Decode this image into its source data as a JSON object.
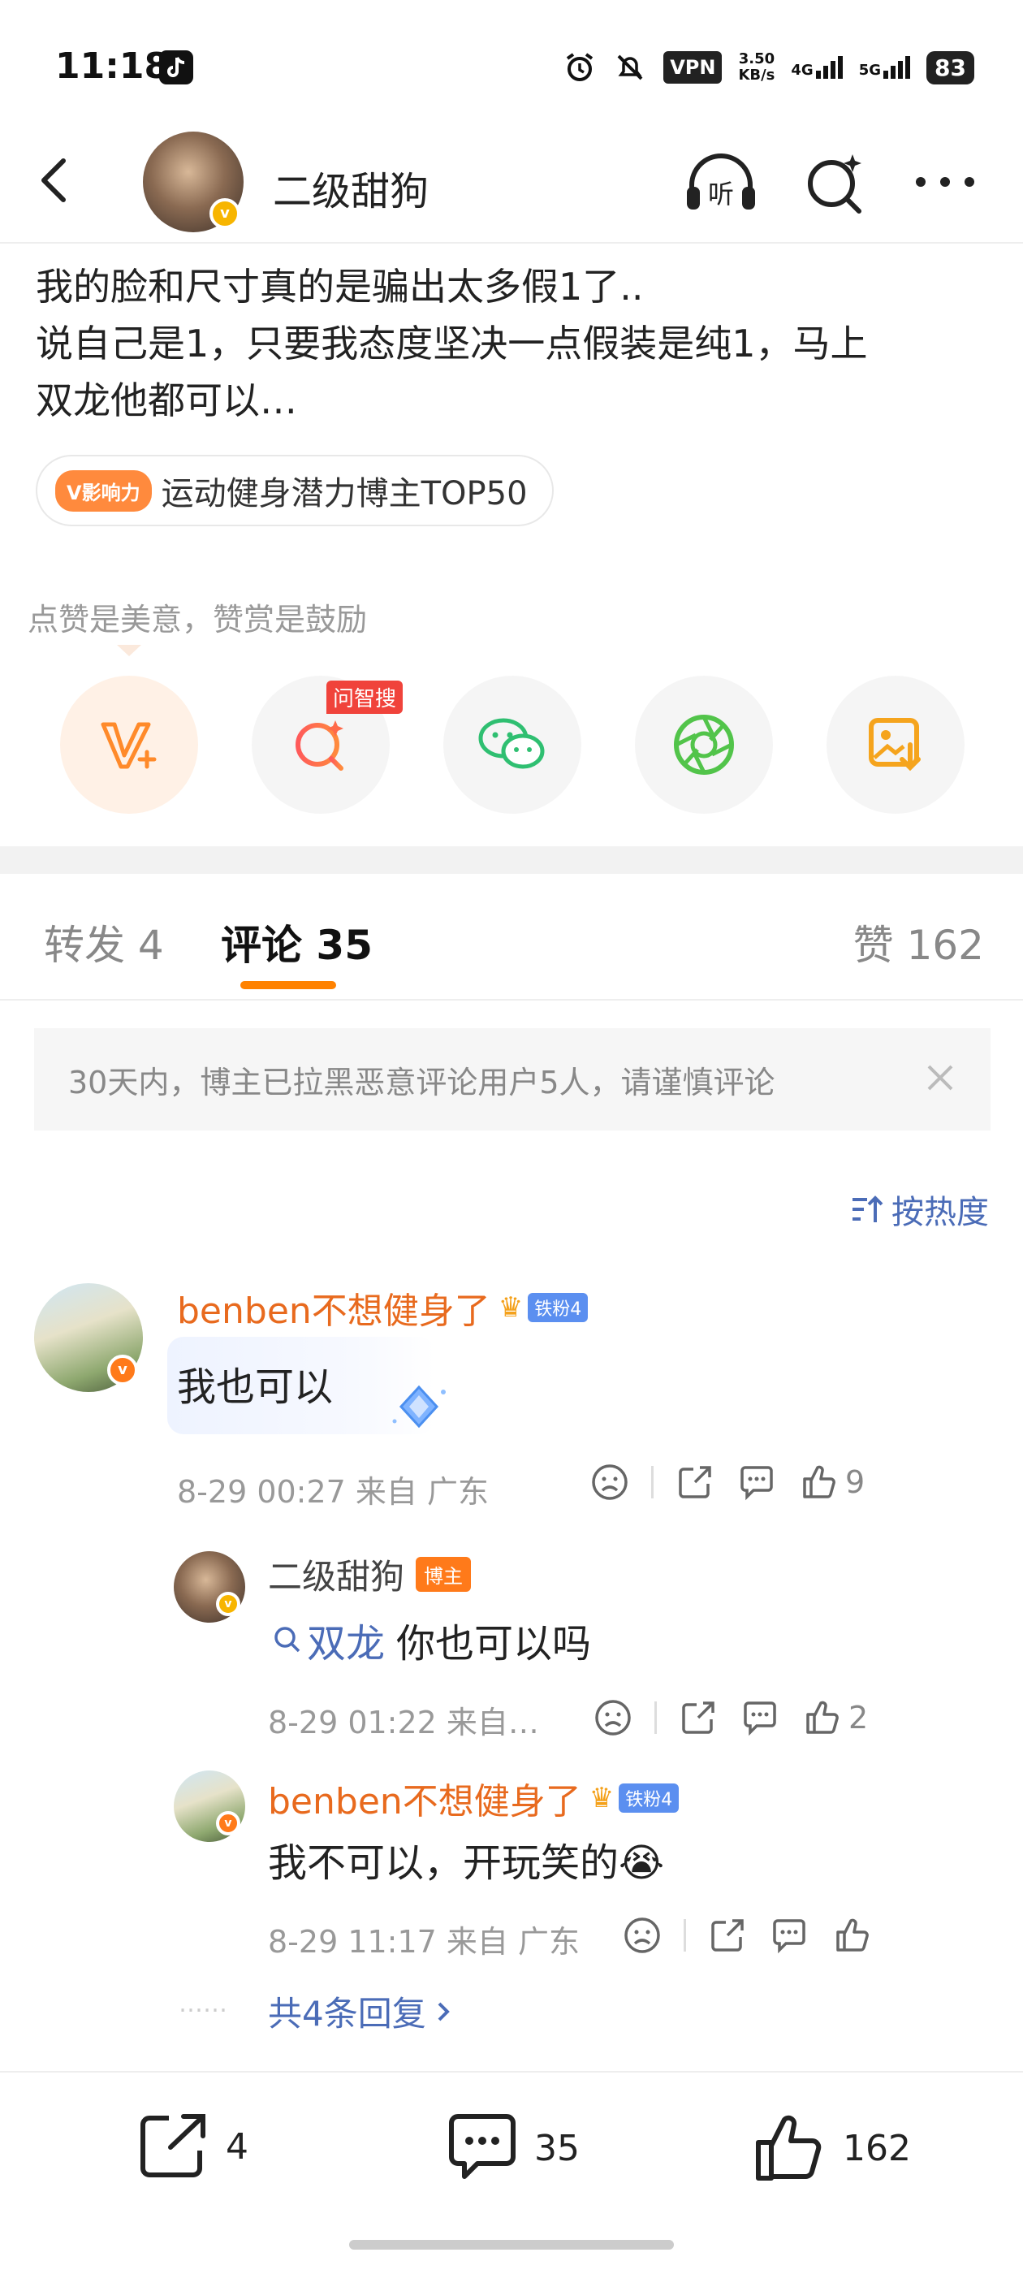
{
  "status_bar": {
    "time": "11:18",
    "vpn": "VPN",
    "speed_value": "3.50",
    "speed_unit": "KB/s",
    "network_1": "4G",
    "network_2": "5G",
    "battery": "83"
  },
  "header": {
    "username": "二级甜狗",
    "listen_icon_text": "听"
  },
  "post": {
    "lines": [
      "我的脸和尺寸真的是骗出太多假1了..",
      "说自己是1，只要我态度坚决一点假装是纯1，马上",
      "双龙他都可以…"
    ],
    "influence_tag": "V影响力",
    "influence_text": "运动健身潜力博主TOP50"
  },
  "support": {
    "text": "点赞是美意，赞赏是鼓励",
    "search_badge": "问智搜"
  },
  "tabs": {
    "repost_label": "转发",
    "repost_count": "4",
    "comment_label": "评论",
    "comment_count": "35",
    "like_label": "赞",
    "like_count": "162"
  },
  "notice": {
    "text": "30天内，博主已拉黑恶意评论用户5人，请谨慎评论"
  },
  "sort": {
    "label": "按热度"
  },
  "comments": {
    "main": {
      "name": "benben不想健身了",
      "fan_badge": "铁粉4",
      "text": "我也可以",
      "meta": "8-29 00:27  来自 广东",
      "like_count": "9"
    },
    "reply1": {
      "name": "二级甜狗",
      "owner_tag": "博主",
      "topic": "双龙",
      "text": "你也可以吗",
      "meta": "8-29 01:22  来自…",
      "like_count": "2"
    },
    "reply2": {
      "name": "benben不想健身了",
      "fan_badge": "铁粉4",
      "text": "我不可以，开玩笑的😭",
      "meta": "8-29 11:17  来自 广东"
    },
    "more": {
      "dots": "……",
      "text": "共4条回复"
    }
  },
  "bottom_bar": {
    "repost": "4",
    "comment": "35",
    "like": "162"
  },
  "colors": {
    "accent_orange": "#ff8200",
    "name_orange": "#e86a1e",
    "link_blue": "#4b6cb7"
  }
}
